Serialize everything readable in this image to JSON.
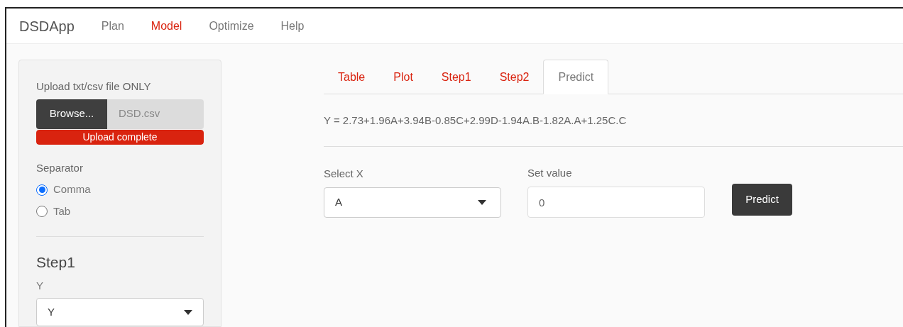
{
  "navbar": {
    "brand": "DSDApp",
    "items": [
      {
        "label": "Plan",
        "selected": false
      },
      {
        "label": "Model",
        "selected": true
      },
      {
        "label": "Optimize",
        "selected": false
      },
      {
        "label": "Help",
        "selected": false
      }
    ]
  },
  "sidebar": {
    "upload_label": "Upload txt/csv file ONLY",
    "browse_button": "Browse...",
    "file_name": "DSD.csv",
    "progress": {
      "text": "Upload complete",
      "level": 1
    },
    "separator": {
      "label": "Separator",
      "options": [
        {
          "label": "Comma",
          "selected": true
        },
        {
          "label": "Tab",
          "selected": false
        }
      ]
    },
    "step_heading": "Step1",
    "y_select": {
      "label": "Y",
      "value": "Y"
    }
  },
  "tabs": [
    {
      "label": "Table",
      "selected": false
    },
    {
      "label": "Plot",
      "selected": false
    },
    {
      "label": "Step1",
      "selected": false
    },
    {
      "label": "Step2",
      "selected": false
    },
    {
      "label": "Predict",
      "selected": true
    }
  ],
  "equation": "Y = 2.73+1.96A+3.94B-0.85C+2.99D-1.94A.B-1.82A.A+1.25C.C",
  "select_x": {
    "label": "Select X",
    "value": "A"
  },
  "set_value": {
    "label": "Set value",
    "value": "0"
  },
  "predict_button": "Predict"
}
